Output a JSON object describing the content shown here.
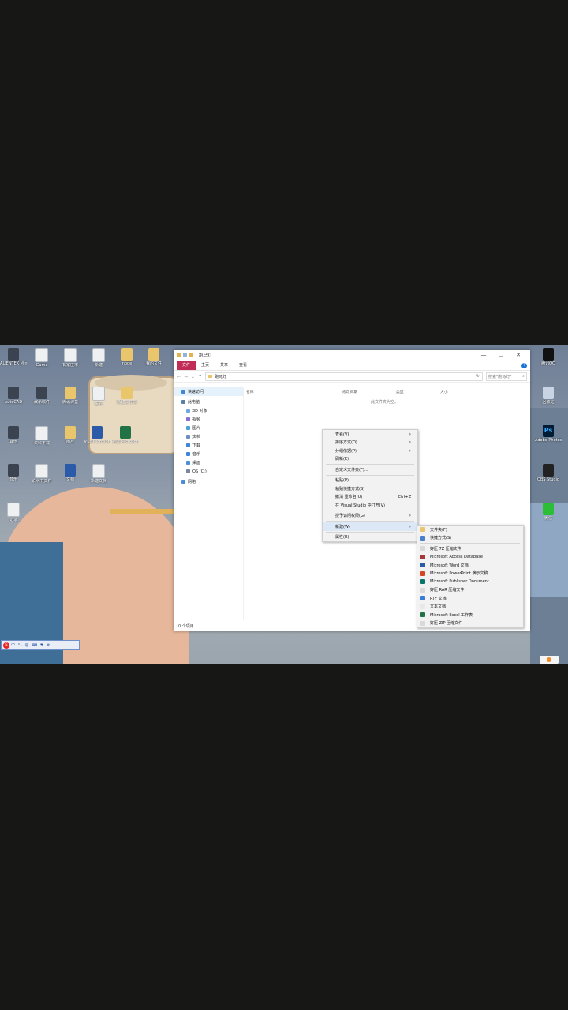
{
  "desktop": {
    "icons": [
      {
        "label": "ALIENTEK MiniSTM...",
        "icon": "app-icon"
      },
      {
        "label": "Game",
        "icon": "file-icon"
      },
      {
        "label": "石家庄市",
        "icon": "file-icon"
      },
      {
        "label": "新建",
        "icon": "file-icon"
      },
      {
        "label": "node",
        "icon": "folder-icon"
      },
      {
        "label": "我的文件",
        "icon": "folder-icon"
      },
      {
        "label": "AutoCAD",
        "icon": "app-icon"
      },
      {
        "label": "演示软件",
        "icon": "app-icon"
      },
      {
        "label": "腾讯课堂",
        "icon": "folder-icon"
      },
      {
        "label": "实验",
        "icon": "file-icon"
      },
      {
        "label": "新建文件夹",
        "icon": "folder-icon"
      },
      {
        "label": "其他",
        "icon": "app-icon"
      },
      {
        "label": "资料下载",
        "icon": "file-icon"
      },
      {
        "label": "图片",
        "icon": "folder-icon"
      },
      {
        "label": "新建 Microsoft Word",
        "icon": "word-icon"
      },
      {
        "label": "新建 Microsoft",
        "icon": "excel-icon"
      },
      {
        "label": "音乐",
        "icon": "app-icon"
      },
      {
        "label": "说明书文件",
        "icon": "file-icon"
      },
      {
        "label": "文档",
        "icon": "word-icon"
      },
      {
        "label": "新建文档",
        "icon": "file-icon"
      },
      {
        "label": "记录",
        "icon": "file-icon"
      }
    ],
    "right_icons": [
      {
        "label": "腾讯QQ",
        "icon": "qq-icon"
      },
      {
        "label": "回收站",
        "icon": "recycle-bin-icon"
      },
      {
        "label": "Adobe Photosh...",
        "icon": "photoshop-icon"
      },
      {
        "label": "OBS Studio",
        "icon": "obs-icon"
      },
      {
        "label": "微信",
        "icon": "wechat-icon"
      }
    ]
  },
  "window": {
    "title": "跑马灯",
    "controls": {
      "minimize": "—",
      "maximize": "☐",
      "close": "✕"
    },
    "ribbon_tabs": [
      "文件",
      "主页",
      "共享",
      "查看"
    ],
    "help": "?",
    "address_path": "跑马灯",
    "search_placeholder": "搜索\"跑马灯\"",
    "nav_items": [
      "快速访问",
      "此电脑",
      "3D 对象",
      "视频",
      "图片",
      "文档",
      "下载",
      "音乐",
      "桌面",
      "OS (C:)",
      "网络"
    ],
    "columns": [
      "名称",
      "修改日期",
      "类型",
      "大小"
    ],
    "empty_message": "此文件夹为空。",
    "status": "0 个项目"
  },
  "context_menu": {
    "items": [
      {
        "label": "查看(V)",
        "has_submenu": true
      },
      {
        "label": "排序方式(O)",
        "has_submenu": true
      },
      {
        "label": "分组依据(P)",
        "has_submenu": true
      },
      {
        "label": "刷新(E)"
      },
      {
        "label": "自定义文件夹(F)..."
      },
      {
        "label": "粘贴(P)"
      },
      {
        "label": "粘贴快捷方式(S)"
      },
      {
        "label": "撤消 重命名(U)",
        "shortcut": "Ctrl+Z"
      },
      {
        "label": "在 Visual Studio 中打开(V)"
      },
      {
        "label": "授予访问权限(G)",
        "has_submenu": true
      },
      {
        "label": "新建(W)",
        "has_submenu": true
      },
      {
        "label": "属性(R)"
      }
    ]
  },
  "new_submenu": {
    "items": [
      {
        "label": "文件夹(F)",
        "color": "#e9c56b"
      },
      {
        "label": "快捷方式(S)",
        "color": "#4a7fc9"
      },
      {
        "label": "好压 7Z 压缩文件",
        "color": "#d9d9d9"
      },
      {
        "label": "Microsoft Access Database",
        "color": "#a4373a"
      },
      {
        "label": "Microsoft Word 文档",
        "color": "#2b5aa8"
      },
      {
        "label": "Microsoft PowerPoint 演示文稿",
        "color": "#d24726"
      },
      {
        "label": "Microsoft Publisher Document",
        "color": "#077568"
      },
      {
        "label": "好压 RAR 压缩文件",
        "color": "#d9d9d9"
      },
      {
        "label": "RTF 文档",
        "color": "#3a7bd5"
      },
      {
        "label": "文本文档",
        "color": "#e8e8e8"
      },
      {
        "label": "Microsoft Excel 工作表",
        "color": "#217346"
      },
      {
        "label": "好压 ZIP 压缩文件",
        "color": "#d9d9d9"
      }
    ]
  },
  "ime_bar": {
    "logo": "S",
    "text": "中 °, ☺ ⌨ ♥ ⚙"
  }
}
